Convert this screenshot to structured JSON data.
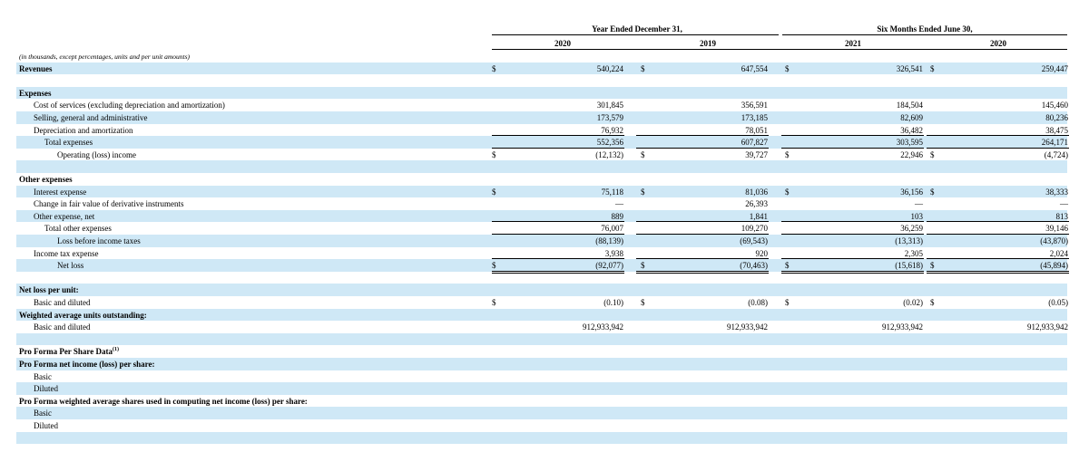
{
  "header": {
    "group1": "Year Ended December 31,",
    "group2": "Six Months Ended June 30,",
    "cols": [
      "2020",
      "2019",
      "2021",
      "2020"
    ]
  },
  "rows": [
    {
      "label": "(in thousands, except percentages, units and per unit amounts)",
      "style": "italic",
      "indent": 0,
      "shade": false,
      "values": null
    },
    {
      "label": "Revenues",
      "style": "bold",
      "indent": 0,
      "shade": true,
      "dollar": true,
      "values": [
        "540,224",
        "647,554",
        "326,541",
        "259,447"
      ]
    },
    {
      "label": "",
      "style": "",
      "indent": 0,
      "shade": false,
      "values": null
    },
    {
      "label": "Expenses",
      "style": "bold",
      "indent": 0,
      "shade": true,
      "values": null
    },
    {
      "label": "Cost of services (excluding depreciation and amortization)",
      "indent": 1,
      "shade": false,
      "values": [
        "301,845",
        "356,591",
        "184,504",
        "145,460"
      ]
    },
    {
      "label": "Selling, general and administrative",
      "indent": 1,
      "shade": true,
      "values": [
        "173,579",
        "173,185",
        "82,609",
        "80,236"
      ]
    },
    {
      "label": "Depreciation and amortization",
      "indent": 1,
      "shade": false,
      "values": [
        "76,932",
        "78,051",
        "36,482",
        "38,475"
      ],
      "under": "single"
    },
    {
      "label": "Total expenses",
      "indent": 2,
      "shade": true,
      "values": [
        "552,356",
        "607,827",
        "303,595",
        "264,171"
      ],
      "under": "single"
    },
    {
      "label": "Operating (loss) income",
      "indent": 3,
      "shade": false,
      "dollar": true,
      "values": [
        "(12,132)",
        "39,727",
        "22,946",
        "(4,724)"
      ]
    },
    {
      "label": "",
      "style": "",
      "indent": 0,
      "shade": true,
      "values": null
    },
    {
      "label": "Other expenses",
      "style": "bold",
      "indent": 0,
      "shade": false,
      "values": null
    },
    {
      "label": "Interest expense",
      "indent": 1,
      "shade": true,
      "dollar": true,
      "values": [
        "75,118",
        "81,036",
        "36,156",
        "38,333"
      ]
    },
    {
      "label": "Change in fair value of derivative instruments",
      "indent": 1,
      "shade": false,
      "values": [
        "—",
        "26,393",
        "—",
        "—"
      ]
    },
    {
      "label": "Other expense, net",
      "indent": 1,
      "shade": true,
      "values": [
        "889",
        "1,841",
        "103",
        "813"
      ],
      "under": "single"
    },
    {
      "label": "Total other expenses",
      "indent": 2,
      "shade": false,
      "values": [
        "76,007",
        "109,270",
        "36,259",
        "39,146"
      ],
      "under": "single"
    },
    {
      "label": "Loss before income taxes",
      "indent": 3,
      "shade": true,
      "values": [
        "(88,139)",
        "(69,543)",
        "(13,313)",
        "(43,870)"
      ]
    },
    {
      "label": "Income tax expense",
      "indent": 1,
      "shade": false,
      "values": [
        "3,938",
        "920",
        "2,305",
        "2,024"
      ],
      "under": "single"
    },
    {
      "label": "Net loss",
      "indent": 3,
      "shade": true,
      "dollar": true,
      "values": [
        "(92,077)",
        "(70,463)",
        "(15,618)",
        "(45,894)"
      ],
      "under": "double"
    },
    {
      "label": "",
      "style": "",
      "indent": 0,
      "shade": false,
      "values": null
    },
    {
      "label": "Net loss per unit:",
      "style": "bold",
      "indent": 0,
      "shade": true,
      "values": null
    },
    {
      "label": "Basic and diluted",
      "indent": 1,
      "shade": false,
      "dollar": true,
      "values": [
        "(0.10)",
        "(0.08)",
        "(0.02)",
        "(0.05)"
      ]
    },
    {
      "label": "Weighted average units outstanding:",
      "style": "bold",
      "indent": 0,
      "shade": true,
      "values": null
    },
    {
      "label": "Basic and diluted",
      "indent": 1,
      "shade": false,
      "values": [
        "912,933,942",
        "912,933,942",
        "912,933,942",
        "912,933,942"
      ]
    },
    {
      "label": "",
      "style": "",
      "indent": 0,
      "shade": true,
      "values": null
    },
    {
      "label": "Pro Forma Per Share Data",
      "sup": "(1)",
      "style": "bold",
      "indent": 0,
      "shade": false,
      "values": null
    },
    {
      "label": "Pro Forma net income (loss) per share:",
      "style": "bold",
      "indent": 0,
      "shade": true,
      "values": null
    },
    {
      "label": "Basic",
      "indent": 1,
      "shade": false,
      "values": null
    },
    {
      "label": "Diluted",
      "indent": 1,
      "shade": true,
      "values": null
    },
    {
      "label": "Pro Forma weighted average shares used in computing net income (loss) per share:",
      "style": "bold",
      "indent": 0,
      "shade": false,
      "values": null
    },
    {
      "label": "Basic",
      "indent": 1,
      "shade": true,
      "values": null
    },
    {
      "label": "Diluted",
      "indent": 1,
      "shade": false,
      "values": null
    },
    {
      "label": "",
      "style": "",
      "indent": 0,
      "shade": true,
      "values": null
    }
  ],
  "dollar_sign": "$"
}
